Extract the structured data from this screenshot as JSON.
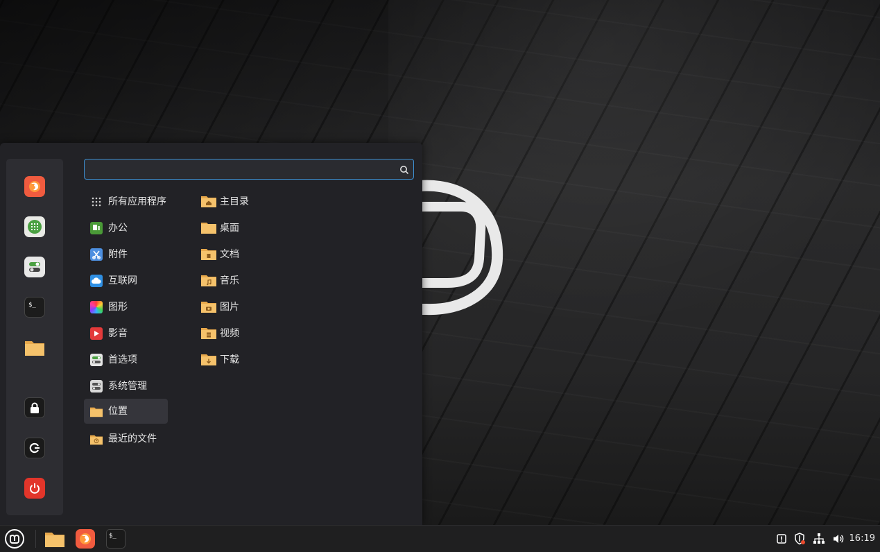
{
  "search": {
    "placeholder": "",
    "value": ""
  },
  "categories": [
    {
      "label": "所有应用程序",
      "icon": "grid-icon"
    },
    {
      "label": "办公",
      "icon": "office-icon"
    },
    {
      "label": "附件",
      "icon": "accessories-icon"
    },
    {
      "label": "互联网",
      "icon": "internet-icon"
    },
    {
      "label": "图形",
      "icon": "graphics-icon"
    },
    {
      "label": "影音",
      "icon": "multimedia-icon"
    },
    {
      "label": "首选项",
      "icon": "preferences-icon"
    },
    {
      "label": "系统管理",
      "icon": "administration-icon"
    },
    {
      "label": "位置",
      "icon": "places-folder-icon",
      "selected": true
    },
    {
      "label": "最近的文件",
      "icon": "recent-files-icon"
    }
  ],
  "places": [
    {
      "label": "主目录",
      "icon": "home-folder-icon"
    },
    {
      "label": "桌面",
      "icon": "desktop-folder-icon"
    },
    {
      "label": "文档",
      "icon": "documents-folder-icon"
    },
    {
      "label": "音乐",
      "icon": "music-folder-icon"
    },
    {
      "label": "图片",
      "icon": "pictures-folder-icon"
    },
    {
      "label": "视频",
      "icon": "videos-folder-icon"
    },
    {
      "label": "下载",
      "icon": "downloads-folder-icon"
    }
  ],
  "favorites": [
    "firefox-icon",
    "spreadsheet-icon",
    "settings-toggle-icon",
    "terminal-icon",
    "folder-icon",
    "lock-icon",
    "logout-icon",
    "power-icon"
  ],
  "panel": {
    "launchers": [
      "files-icon",
      "firefox-icon",
      "terminal-icon"
    ],
    "tray": [
      "notification-icon",
      "update-shield-icon",
      "network-icon",
      "volume-icon"
    ],
    "clock": "16:19"
  },
  "colors": {
    "accent": "#3d8fd1",
    "folder": "#f5c26b",
    "menu_bg": "#222226"
  }
}
